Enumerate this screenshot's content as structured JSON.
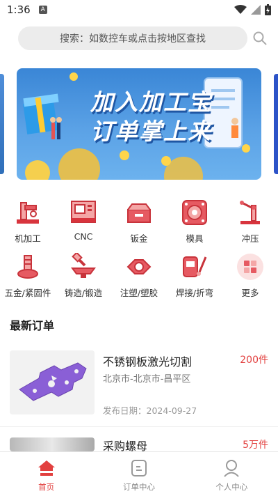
{
  "status": {
    "time": "1:36",
    "notification_glyph": "A"
  },
  "search": {
    "placeholder": "搜索：如数控车或点击按地区查找"
  },
  "banner": {
    "line1": "加入加工宝",
    "line2": "订单掌上来"
  },
  "categories": [
    {
      "label": "机加工",
      "icon": "machining-icon"
    },
    {
      "label": "CNC",
      "icon": "cnc-icon"
    },
    {
      "label": "钣金",
      "icon": "sheet-metal-icon"
    },
    {
      "label": "模具",
      "icon": "mold-icon"
    },
    {
      "label": "冲压",
      "icon": "stamping-icon"
    },
    {
      "label": "五金/紧固件",
      "icon": "hardware-icon"
    },
    {
      "label": "铸造/锻造",
      "icon": "casting-icon"
    },
    {
      "label": "注塑/塑胶",
      "icon": "injection-icon"
    },
    {
      "label": "焊接/折弯",
      "icon": "welding-icon"
    },
    {
      "label": "更多",
      "icon": "more-icon"
    }
  ],
  "section": {
    "title": "最新订单"
  },
  "orders": [
    {
      "title": "不锈钢板激光切割",
      "quantity": "200件",
      "location": "北京市-北京市-昌平区",
      "date_label": "发布日期：2024-09-27"
    },
    {
      "title": "采购螺母",
      "quantity": "5万件"
    }
  ],
  "tabs": [
    {
      "label": "首页",
      "active": true
    },
    {
      "label": "订单中心",
      "active": false
    },
    {
      "label": "个人中心",
      "active": false
    }
  ],
  "colors": {
    "accent": "#e2403f",
    "banner_blue": "#3a86d6"
  }
}
